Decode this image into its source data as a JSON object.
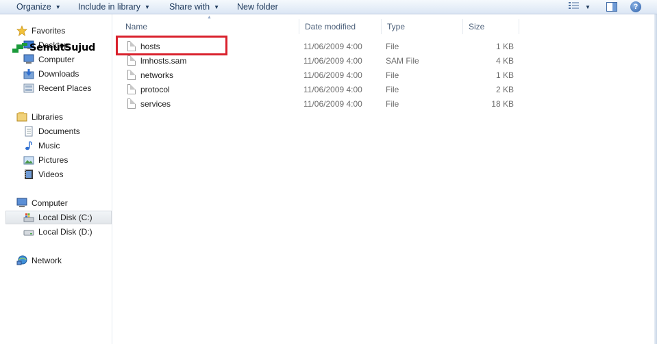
{
  "toolbar": {
    "organize": "Organize",
    "include_in_library": "Include in library",
    "share_with": "Share with",
    "new_folder": "New folder",
    "view_icon": "view-options-icon",
    "preview_icon": "preview-pane-icon",
    "help_icon": "help-icon",
    "help_glyph": "?"
  },
  "nav": {
    "favorites": {
      "label": "Favorites",
      "icon": "star-icon"
    },
    "favorites_items": [
      {
        "label": "Desktop",
        "icon": "desktop-icon"
      },
      {
        "label": "Computer",
        "icon": "computer-icon"
      },
      {
        "label": "Downloads",
        "icon": "downloads-icon"
      },
      {
        "label": "Recent Places",
        "icon": "recent-places-icon"
      }
    ],
    "libraries": {
      "label": "Libraries",
      "icon": "libraries-icon"
    },
    "libraries_items": [
      {
        "label": "Documents",
        "icon": "documents-icon"
      },
      {
        "label": "Music",
        "icon": "music-icon"
      },
      {
        "label": "Pictures",
        "icon": "pictures-icon"
      },
      {
        "label": "Videos",
        "icon": "videos-icon"
      }
    ],
    "computer": {
      "label": "Computer",
      "icon": "computer-icon"
    },
    "computer_items": [
      {
        "label": "Local Disk (C:)",
        "icon": "local-disk-icon",
        "selected": true
      },
      {
        "label": "Local Disk (D:)",
        "icon": "drive-icon",
        "selected": false
      }
    ],
    "network": {
      "label": "Network",
      "icon": "network-icon"
    }
  },
  "watermark": {
    "text": "SemutSujud",
    "color": "#1a9a3a"
  },
  "columns": {
    "name": "Name",
    "date": "Date modified",
    "type": "Type",
    "size": "Size"
  },
  "files": [
    {
      "name": "hosts",
      "date": "11/06/2009 4:00",
      "type": "File",
      "size": "1 KB"
    },
    {
      "name": "lmhosts.sam",
      "date": "11/06/2009 4:00",
      "type": "SAM File",
      "size": "4 KB"
    },
    {
      "name": "networks",
      "date": "11/06/2009 4:00",
      "type": "File",
      "size": "1 KB"
    },
    {
      "name": "protocol",
      "date": "11/06/2009 4:00",
      "type": "File",
      "size": "2 KB"
    },
    {
      "name": "services",
      "date": "11/06/2009 4:00",
      "type": "File",
      "size": "18 KB"
    }
  ],
  "highlight_color": "#d9202c"
}
